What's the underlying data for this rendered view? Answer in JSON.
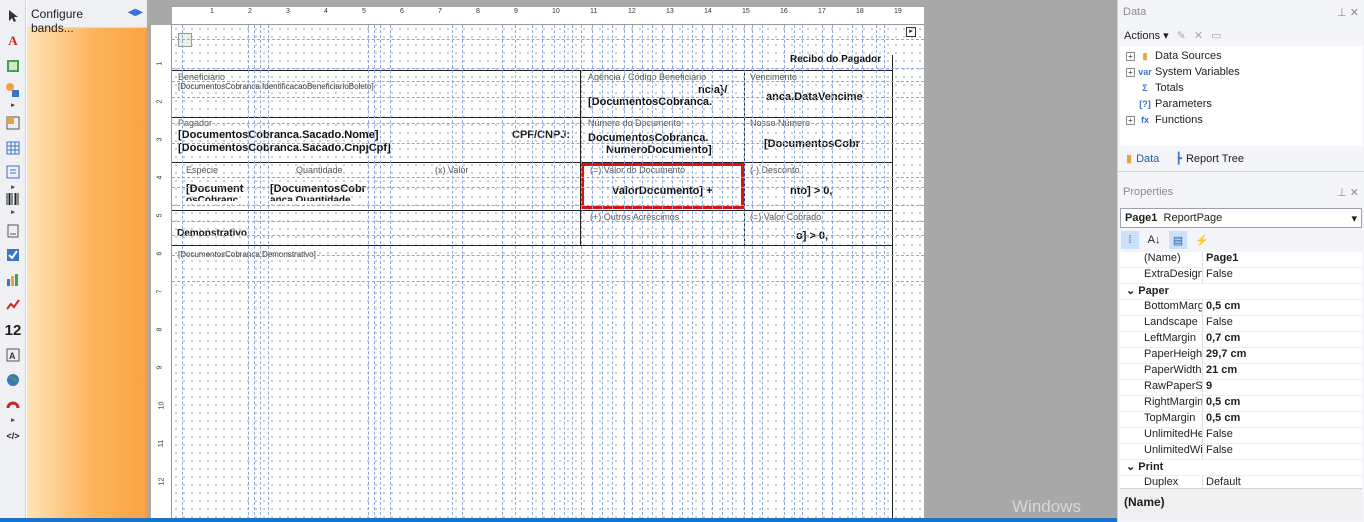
{
  "toolbox": {
    "items": [
      "pointer-icon",
      "text-icon",
      "image-icon",
      "shape-icon",
      "more-arrow-icon",
      "panel-icon",
      "table-icon",
      "subreport-icon",
      "more-arrow-icon",
      "barcode-icon",
      "more-arrow-icon",
      "zip-code-icon",
      "checkbox-icon",
      "chart-icon",
      "sparkline-icon",
      "numeric-icon",
      "label-icon",
      "map-icon",
      "gauge-icon",
      "more-arrow-icon",
      "html-icon"
    ],
    "numeric_glyph": "12",
    "html_glyph": "</>",
    "text_glyph": "A"
  },
  "bands_panel": {
    "title": "Configure bands..."
  },
  "ruler": {
    "numbers": [
      "1",
      "2",
      "3",
      "4",
      "5",
      "6",
      "7",
      "8",
      "9",
      "10",
      "11",
      "12",
      "13",
      "14",
      "15",
      "16",
      "17",
      "18",
      "19"
    ],
    "vnumbers": [
      "1",
      "2",
      "3",
      "4",
      "5",
      "6",
      "7",
      "8",
      "9",
      "10",
      "11",
      "12"
    ]
  },
  "report": {
    "recibo": "Recibo do Pagador",
    "beneficiario_label": "Beneficiário",
    "beneficiario_value": "[DocumentosCobranca.IdentificacaoBeneficiarioBoleto]",
    "agencia_label": "Agência / Código Beneficiário",
    "agencia_value1": "ncia}/",
    "agencia_value2": "[DocumentosCobranca.",
    "vencimento_label": "Vencimento",
    "vencimento_value": "anca.DataVencime",
    "pagador_label": "Pagador",
    "sacado_nome": "[DocumentosCobranca.Sacado.Nome]",
    "sacado_cnpj": "[DocumentosCobranca.Sacado.CnpjCpf]",
    "cpf_label": "CPF/CNPJ:",
    "numero_label": "Número do Documento",
    "numero_value1": "DocumentosCobranca.",
    "numero_value2": "NumeroDocumento]",
    "nosso_label": "Nosso Número",
    "nosso_value": "[DocumentosCobr",
    "especie_label": "Espécie",
    "quantidade_label": "Quantidade",
    "xvalor_label": "(x) Valor",
    "especie_value": "[Document",
    "especie_value2": "osCobranc",
    "quantidade_value": "[DocumentosCobr",
    "quantidade_value2": "anca.Quantidade",
    "valor_doc_label": "(=) Valor do Documento",
    "valor_doc_value": "ValorDocumento] +",
    "desconto_label": "(-) Desconto",
    "desconto_value": "nto] > 0,",
    "outros_label": "(+) Outros Acréscimos",
    "valor_cobrado_label": "(=) Valor Cobrado",
    "valor_cobrado_value": "o] > 0,",
    "demonstrativo_label": "Demonstrativo",
    "demonstrativo_value": "[DocumentosCobranca.Demonstrativo]"
  },
  "data_panel": {
    "title": "Data",
    "actions_label": "Actions",
    "tree": [
      {
        "label": "Data Sources",
        "icon": "database-icon"
      },
      {
        "label": "System Variables",
        "icon": "variable-icon"
      },
      {
        "label": "Totals",
        "icon": "sigma-icon"
      },
      {
        "label": "Parameters",
        "icon": "parameters-icon"
      },
      {
        "label": "Functions",
        "icon": "function-icon"
      }
    ],
    "tabs": [
      "Data",
      "Report Tree"
    ]
  },
  "properties_panel": {
    "title": "Properties",
    "object_name": "Page1",
    "object_type": "ReportPage",
    "rows": [
      {
        "name": "(Name)",
        "value": "Page1",
        "bold": true
      },
      {
        "name": "ExtraDesignWidth",
        "value": "False"
      },
      {
        "category": "Paper"
      },
      {
        "name": "BottomMargin",
        "value": "0,5 cm",
        "bold": true
      },
      {
        "name": "Landscape",
        "value": "False"
      },
      {
        "name": "LeftMargin",
        "value": "0,7 cm",
        "bold": true
      },
      {
        "name": "PaperHeight",
        "value": "29,7 cm",
        "bold": true
      },
      {
        "name": "PaperWidth",
        "value": "21 cm",
        "bold": true
      },
      {
        "name": "RawPaperSize",
        "value": "9",
        "bold": true
      },
      {
        "name": "RightMargin",
        "value": "0,5 cm",
        "bold": true
      },
      {
        "name": "TopMargin",
        "value": "0,5 cm",
        "bold": true
      },
      {
        "name": "UnlimitedHeight",
        "value": "False"
      },
      {
        "name": "UnlimitedWidth",
        "value": "False"
      },
      {
        "category": "Print"
      },
      {
        "name": "Duplex",
        "value": "Default"
      }
    ],
    "description": "(Name)"
  },
  "watermark": "Windows",
  "colors": {
    "accent": "#1b73c9",
    "selection": "#dd1111",
    "bands": "#fdb45c"
  }
}
